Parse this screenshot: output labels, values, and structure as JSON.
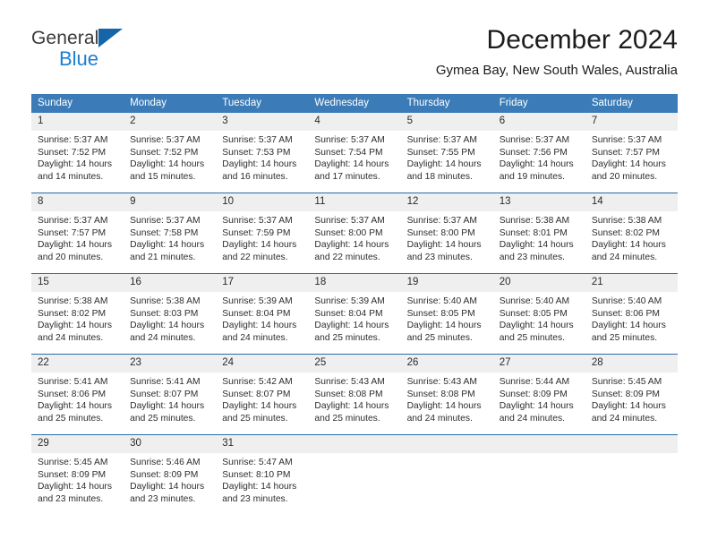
{
  "brand": {
    "name_top": "General",
    "name_bottom": "Blue",
    "accent_color": "#1b7fd4",
    "triangle_color": "#1565a8"
  },
  "header": {
    "title": "December 2024",
    "subtitle": "Gymea Bay, New South Wales, Australia"
  },
  "calendar": {
    "header_bg": "#3b7cb8",
    "daynum_bg": "#efefef",
    "row_divider_color": "#2b6ca8",
    "weekday_headers": [
      "Sunday",
      "Monday",
      "Tuesday",
      "Wednesday",
      "Thursday",
      "Friday",
      "Saturday"
    ],
    "weeks": [
      [
        {
          "day": "1",
          "sunrise": "Sunrise: 5:37 AM",
          "sunset": "Sunset: 7:52 PM",
          "daylight_line1": "Daylight: 14 hours",
          "daylight_line2": "and 14 minutes."
        },
        {
          "day": "2",
          "sunrise": "Sunrise: 5:37 AM",
          "sunset": "Sunset: 7:52 PM",
          "daylight_line1": "Daylight: 14 hours",
          "daylight_line2": "and 15 minutes."
        },
        {
          "day": "3",
          "sunrise": "Sunrise: 5:37 AM",
          "sunset": "Sunset: 7:53 PM",
          "daylight_line1": "Daylight: 14 hours",
          "daylight_line2": "and 16 minutes."
        },
        {
          "day": "4",
          "sunrise": "Sunrise: 5:37 AM",
          "sunset": "Sunset: 7:54 PM",
          "daylight_line1": "Daylight: 14 hours",
          "daylight_line2": "and 17 minutes."
        },
        {
          "day": "5",
          "sunrise": "Sunrise: 5:37 AM",
          "sunset": "Sunset: 7:55 PM",
          "daylight_line1": "Daylight: 14 hours",
          "daylight_line2": "and 18 minutes."
        },
        {
          "day": "6",
          "sunrise": "Sunrise: 5:37 AM",
          "sunset": "Sunset: 7:56 PM",
          "daylight_line1": "Daylight: 14 hours",
          "daylight_line2": "and 19 minutes."
        },
        {
          "day": "7",
          "sunrise": "Sunrise: 5:37 AM",
          "sunset": "Sunset: 7:57 PM",
          "daylight_line1": "Daylight: 14 hours",
          "daylight_line2": "and 20 minutes."
        }
      ],
      [
        {
          "day": "8",
          "sunrise": "Sunrise: 5:37 AM",
          "sunset": "Sunset: 7:57 PM",
          "daylight_line1": "Daylight: 14 hours",
          "daylight_line2": "and 20 minutes."
        },
        {
          "day": "9",
          "sunrise": "Sunrise: 5:37 AM",
          "sunset": "Sunset: 7:58 PM",
          "daylight_line1": "Daylight: 14 hours",
          "daylight_line2": "and 21 minutes."
        },
        {
          "day": "10",
          "sunrise": "Sunrise: 5:37 AM",
          "sunset": "Sunset: 7:59 PM",
          "daylight_line1": "Daylight: 14 hours",
          "daylight_line2": "and 22 minutes."
        },
        {
          "day": "11",
          "sunrise": "Sunrise: 5:37 AM",
          "sunset": "Sunset: 8:00 PM",
          "daylight_line1": "Daylight: 14 hours",
          "daylight_line2": "and 22 minutes."
        },
        {
          "day": "12",
          "sunrise": "Sunrise: 5:37 AM",
          "sunset": "Sunset: 8:00 PM",
          "daylight_line1": "Daylight: 14 hours",
          "daylight_line2": "and 23 minutes."
        },
        {
          "day": "13",
          "sunrise": "Sunrise: 5:38 AM",
          "sunset": "Sunset: 8:01 PM",
          "daylight_line1": "Daylight: 14 hours",
          "daylight_line2": "and 23 minutes."
        },
        {
          "day": "14",
          "sunrise": "Sunrise: 5:38 AM",
          "sunset": "Sunset: 8:02 PM",
          "daylight_line1": "Daylight: 14 hours",
          "daylight_line2": "and 24 minutes."
        }
      ],
      [
        {
          "day": "15",
          "sunrise": "Sunrise: 5:38 AM",
          "sunset": "Sunset: 8:02 PM",
          "daylight_line1": "Daylight: 14 hours",
          "daylight_line2": "and 24 minutes."
        },
        {
          "day": "16",
          "sunrise": "Sunrise: 5:38 AM",
          "sunset": "Sunset: 8:03 PM",
          "daylight_line1": "Daylight: 14 hours",
          "daylight_line2": "and 24 minutes."
        },
        {
          "day": "17",
          "sunrise": "Sunrise: 5:39 AM",
          "sunset": "Sunset: 8:04 PM",
          "daylight_line1": "Daylight: 14 hours",
          "daylight_line2": "and 24 minutes."
        },
        {
          "day": "18",
          "sunrise": "Sunrise: 5:39 AM",
          "sunset": "Sunset: 8:04 PM",
          "daylight_line1": "Daylight: 14 hours",
          "daylight_line2": "and 25 minutes."
        },
        {
          "day": "19",
          "sunrise": "Sunrise: 5:40 AM",
          "sunset": "Sunset: 8:05 PM",
          "daylight_line1": "Daylight: 14 hours",
          "daylight_line2": "and 25 minutes."
        },
        {
          "day": "20",
          "sunrise": "Sunrise: 5:40 AM",
          "sunset": "Sunset: 8:05 PM",
          "daylight_line1": "Daylight: 14 hours",
          "daylight_line2": "and 25 minutes."
        },
        {
          "day": "21",
          "sunrise": "Sunrise: 5:40 AM",
          "sunset": "Sunset: 8:06 PM",
          "daylight_line1": "Daylight: 14 hours",
          "daylight_line2": "and 25 minutes."
        }
      ],
      [
        {
          "day": "22",
          "sunrise": "Sunrise: 5:41 AM",
          "sunset": "Sunset: 8:06 PM",
          "daylight_line1": "Daylight: 14 hours",
          "daylight_line2": "and 25 minutes."
        },
        {
          "day": "23",
          "sunrise": "Sunrise: 5:41 AM",
          "sunset": "Sunset: 8:07 PM",
          "daylight_line1": "Daylight: 14 hours",
          "daylight_line2": "and 25 minutes."
        },
        {
          "day": "24",
          "sunrise": "Sunrise: 5:42 AM",
          "sunset": "Sunset: 8:07 PM",
          "daylight_line1": "Daylight: 14 hours",
          "daylight_line2": "and 25 minutes."
        },
        {
          "day": "25",
          "sunrise": "Sunrise: 5:43 AM",
          "sunset": "Sunset: 8:08 PM",
          "daylight_line1": "Daylight: 14 hours",
          "daylight_line2": "and 25 minutes."
        },
        {
          "day": "26",
          "sunrise": "Sunrise: 5:43 AM",
          "sunset": "Sunset: 8:08 PM",
          "daylight_line1": "Daylight: 14 hours",
          "daylight_line2": "and 24 minutes."
        },
        {
          "day": "27",
          "sunrise": "Sunrise: 5:44 AM",
          "sunset": "Sunset: 8:09 PM",
          "daylight_line1": "Daylight: 14 hours",
          "daylight_line2": "and 24 minutes."
        },
        {
          "day": "28",
          "sunrise": "Sunrise: 5:45 AM",
          "sunset": "Sunset: 8:09 PM",
          "daylight_line1": "Daylight: 14 hours",
          "daylight_line2": "and 24 minutes."
        }
      ],
      [
        {
          "day": "29",
          "sunrise": "Sunrise: 5:45 AM",
          "sunset": "Sunset: 8:09 PM",
          "daylight_line1": "Daylight: 14 hours",
          "daylight_line2": "and 23 minutes."
        },
        {
          "day": "30",
          "sunrise": "Sunrise: 5:46 AM",
          "sunset": "Sunset: 8:09 PM",
          "daylight_line1": "Daylight: 14 hours",
          "daylight_line2": "and 23 minutes."
        },
        {
          "day": "31",
          "sunrise": "Sunrise: 5:47 AM",
          "sunset": "Sunset: 8:10 PM",
          "daylight_line1": "Daylight: 14 hours",
          "daylight_line2": "and 23 minutes."
        },
        {
          "day": "",
          "sunrise": "",
          "sunset": "",
          "daylight_line1": "",
          "daylight_line2": ""
        },
        {
          "day": "",
          "sunrise": "",
          "sunset": "",
          "daylight_line1": "",
          "daylight_line2": ""
        },
        {
          "day": "",
          "sunrise": "",
          "sunset": "",
          "daylight_line1": "",
          "daylight_line2": ""
        },
        {
          "day": "",
          "sunrise": "",
          "sunset": "",
          "daylight_line1": "",
          "daylight_line2": ""
        }
      ]
    ]
  }
}
